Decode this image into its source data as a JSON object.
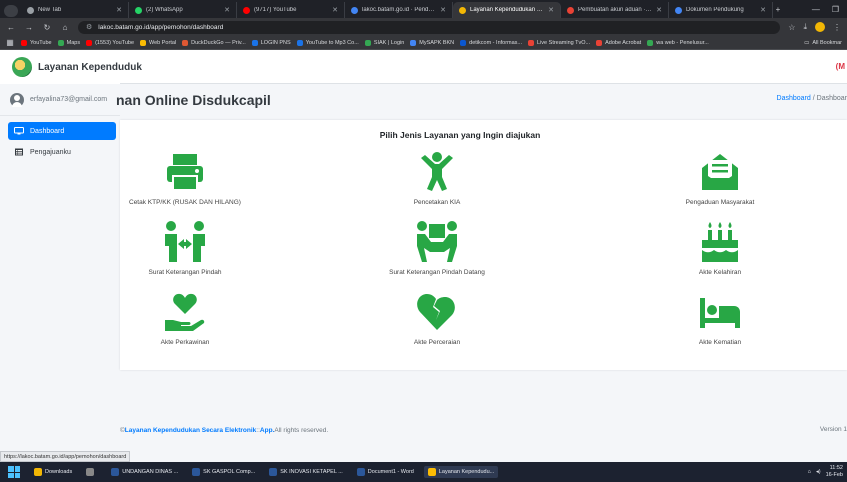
{
  "browser": {
    "tabs": [
      {
        "label": "New Tab",
        "color": "#9aa0a6"
      },
      {
        "label": "(2) WhatsApp",
        "color": "#25d366"
      },
      {
        "label": "(9717) YouTube",
        "color": "#ff0000"
      },
      {
        "label": "lakoc.batam.go.id · Pendaftaran",
        "color": "#4285f4"
      },
      {
        "label": "Layanan Kependudukan Secara",
        "color": "#f2b705"
      },
      {
        "label": "Pembuatan akun aduan · erfa",
        "color": "#e94235"
      },
      {
        "label": "Dokumen Pendukung",
        "color": "#4285f4"
      }
    ],
    "active_tab_index": 4,
    "url": "lakoc.batam.go.id/app/pemohon/dashboard",
    "bookmarks": [
      {
        "label": "YouTube",
        "color": "#ff0000"
      },
      {
        "label": "Maps",
        "color": "#34a853"
      },
      {
        "label": "(1553) YouTube",
        "color": "#ff0000"
      },
      {
        "label": "Web Portal",
        "color": "#fbbc04"
      },
      {
        "label": "DuckDuckGo — Priv...",
        "color": "#de5833"
      },
      {
        "label": "LOGIN PNS",
        "color": "#1a73e8"
      },
      {
        "label": "YouTube to Mp3 Co...",
        "color": "#1a73e8"
      },
      {
        "label": "SIAK | Login",
        "color": "#34a853"
      },
      {
        "label": "MySAPK BKN",
        "color": "#4285f4"
      },
      {
        "label": "detikcom - Informas...",
        "color": "#0b57d0"
      },
      {
        "label": "Live Streaming TvO...",
        "color": "#e94235"
      },
      {
        "label": "Adobe Acrobat",
        "color": "#e94235"
      },
      {
        "label": "wa web - Penelusur...",
        "color": "#34a853"
      }
    ],
    "all_bookmarks_label": "All Bookmar"
  },
  "app": {
    "brand": "Layanan Kependuduk",
    "topnav_right": "(M",
    "user_email": "erfayalina73@gmail.com",
    "nav": [
      {
        "label": "Dashboard",
        "active": true
      },
      {
        "label": "Pengajuanku",
        "active": false
      }
    ],
    "page_title": "nan Online Disdukcapil",
    "breadcrumb": {
      "link": "Dashboard",
      "separator": "/",
      "current": "Dashboar"
    },
    "card_title": "Pilih Jenis Layanan yang Ingin diajukan",
    "services": [
      {
        "label": "Cetak KTP/KK (RUSAK DAN HILANG)",
        "icon": "printer-icon"
      },
      {
        "label": "Pencetakan KIA",
        "icon": "child-icon"
      },
      {
        "label": "Pengaduan Masyarakat",
        "icon": "envelope-open-icon"
      },
      {
        "label": "Surat Keterangan Pindah",
        "icon": "people-arrows-icon"
      },
      {
        "label": "Surat Keterangan Pindah Datang",
        "icon": "people-carry-icon"
      },
      {
        "label": "Akte Kelahiran",
        "icon": "birthday-cake-icon"
      },
      {
        "label": "Akte Perkawinan",
        "icon": "hand-holding-heart-icon"
      },
      {
        "label": "Akte Perceraian",
        "icon": "heart-broken-icon"
      },
      {
        "label": "Akte Kematian",
        "icon": "bed-icon"
      }
    ],
    "footer": {
      "prefix": "© ",
      "link": "Layanan Kependudukan Secara Elektronik",
      "middle": " :: ",
      "app": "App.",
      "suffix": " All rights reserved.",
      "version": "Version 1"
    },
    "status_url": "https://lakoc.batam.go.id/app/pemohon/dashboard",
    "accent_color": "#007bff",
    "icon_color": "#28a745"
  },
  "taskbar": {
    "items": [
      {
        "label": "Downloads",
        "color": "#f2b705",
        "active": false
      },
      {
        "label": "",
        "color": "#888888",
        "active": false
      },
      {
        "label": "UNDANGAN DINAS ...",
        "color": "#2b579a",
        "active": false
      },
      {
        "label": "SK GASPOL  Comp...",
        "color": "#2b579a",
        "active": false
      },
      {
        "label": "SK INOVASI KETAPEL ...",
        "color": "#2b579a",
        "active": false
      },
      {
        "label": "Document1 - Word",
        "color": "#2b579a",
        "active": false
      },
      {
        "label": "Layanan Kependudu...",
        "color": "#fbbc04",
        "active": true
      }
    ],
    "time": "11:52",
    "date": "16-Feb"
  }
}
